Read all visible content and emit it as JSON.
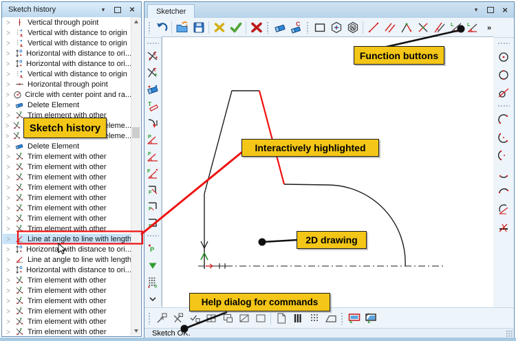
{
  "colors": {
    "label_bg": "#F3C617",
    "label_border": "#1a1a1a",
    "annotation_red": "#EE1111",
    "annotation_black": "#111111",
    "selection_bg": "#C9E3F8"
  },
  "history_panel": {
    "title": "Sketch history",
    "window_buttons": [
      "menu",
      "maximize",
      "close"
    ],
    "items": [
      {
        "icon": "vertical-point",
        "label": "Vertical through point"
      },
      {
        "icon": "vertical-distance",
        "label": "Vertical with distance to origin"
      },
      {
        "icon": "vertical-distance",
        "label": "Vertical with distance to origin"
      },
      {
        "icon": "horizontal-distance",
        "label": "Horizontal with distance to ori..."
      },
      {
        "icon": "horizontal-distance",
        "label": "Horizontal with distance to ori..."
      },
      {
        "icon": "vertical-distance",
        "label": "Vertical with distance to origin"
      },
      {
        "icon": "horizontal-point",
        "label": "Horizontal through point"
      },
      {
        "icon": "circle-center-radius",
        "label": "Circle with center point and ra..."
      },
      {
        "icon": "delete",
        "label": "Delete Element"
      },
      {
        "icon": "trim",
        "label": "Trim element with other"
      },
      {
        "icon": "trim",
        "label": "Trim element with other eleme..."
      },
      {
        "icon": "trim",
        "label": "Trim element with other eleme..."
      },
      {
        "icon": "delete",
        "label": "Delete Element"
      },
      {
        "icon": "trim",
        "label": "Trim element with other"
      },
      {
        "icon": "trim",
        "label": "Trim element with other"
      },
      {
        "icon": "trim",
        "label": "Trim element with other"
      },
      {
        "icon": "trim",
        "label": "Trim element with other"
      },
      {
        "icon": "trim",
        "label": "Trim element with other"
      },
      {
        "icon": "trim",
        "label": "Trim element with other"
      },
      {
        "icon": "trim",
        "label": "Trim element with other"
      },
      {
        "icon": "trim",
        "label": "Trim element with other"
      },
      {
        "icon": "line-angle-length",
        "label": "Line at angle to line with length",
        "selected": true
      },
      {
        "icon": "horizontal-distance",
        "label": "Horizontal with distance to ori..."
      },
      {
        "icon": "line-angle-length",
        "label": "Line at angle to line with length"
      },
      {
        "icon": "horizontal-distance",
        "label": "Horizontal with distance to ori..."
      },
      {
        "icon": "trim",
        "label": "Trim element with other"
      },
      {
        "icon": "trim",
        "label": "Trim element with other"
      },
      {
        "icon": "trim",
        "label": "Trim element with other"
      },
      {
        "icon": "trim",
        "label": "Trim element with other"
      },
      {
        "icon": "trim",
        "label": "Trim element with other"
      },
      {
        "icon": "trim",
        "label": "Trim element with other"
      }
    ]
  },
  "sketcher": {
    "title": "Sketcher",
    "window_buttons": [
      "menu",
      "maximize",
      "close"
    ],
    "status_text": "Sketch OK.",
    "main_toolbar": [
      "grip",
      "undo",
      "|",
      "open-folder",
      "save",
      "|",
      "discard",
      "accept",
      "|",
      "cancel",
      "grip",
      "eraser",
      "eraser-c",
      "grip",
      "rectangle",
      "hexagon-h",
      "hexagon-n",
      "|",
      "line",
      "parallel-lines",
      "angle-line",
      "cross-lines",
      "double-angle-line",
      "length-angle-1",
      "length-angle-2",
      "more"
    ],
    "left_toolbar": [
      "grip",
      "trim-t",
      "trim-t-plus",
      "delete-element",
      "tangent-line",
      "corner-arrow",
      "p-angle",
      "f-angle-1",
      "f-angle-2",
      "f-corner-1",
      "f-corner-2",
      "f-corner-3",
      "grip",
      "point-p",
      "green-triangle-down",
      "grid-points",
      "chevron-down"
    ],
    "right_toolbar": [
      "grip",
      "circle-center-point",
      "circle",
      "circle-tangent",
      "grip",
      "arc-1",
      "arc-2",
      "arc-3",
      "arc-4",
      "arc-5",
      "arc-angle",
      "axis-line"
    ],
    "bottom_toolbar": [
      "grip",
      "zoom-window",
      "zoom-cross",
      "pan-check",
      "grid-window",
      "window-small",
      "window-diag",
      "window-plain",
      "|",
      "page-fold",
      "bars",
      "bars-dotted",
      "trapezoid",
      "grip",
      "screen-red",
      "screen-blue"
    ]
  },
  "annotations": {
    "sketch_history": "Sketch history",
    "function_buttons": "Function buttons",
    "interactively_highlighted": "Interactively highlighted",
    "drawing_2d": "2D drawing",
    "help_dialog": "Help dialog for commands"
  }
}
